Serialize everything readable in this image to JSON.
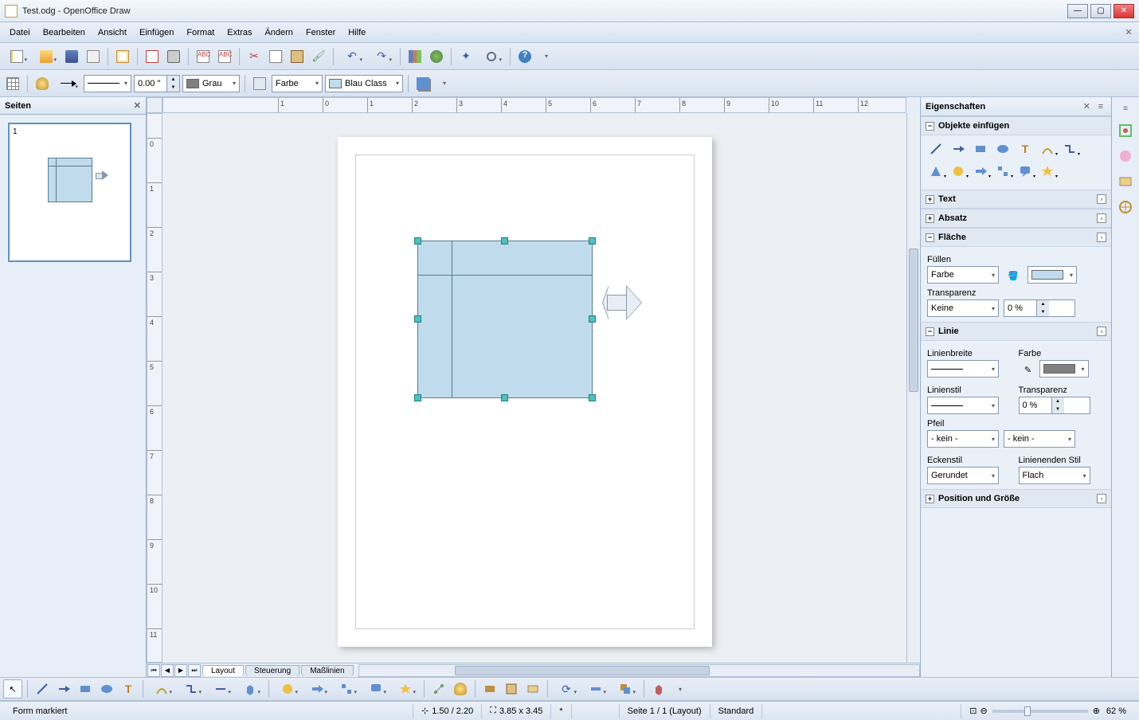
{
  "app": {
    "title": "Test.odg - OpenOffice Draw"
  },
  "menu": [
    "Datei",
    "Bearbeiten",
    "Ansicht",
    "Einfügen",
    "Format",
    "Extras",
    "Ändern",
    "Fenster",
    "Hilfe"
  ],
  "toolbar2": {
    "line_width": "0.00 \"",
    "line_color_label": "Grau",
    "fill_mode": "Farbe",
    "fill_color_label": "Blau Class"
  },
  "pages_panel": {
    "title": "Seiten",
    "page_number": "1"
  },
  "tabs": [
    "Layout",
    "Steuerung",
    "Maßlinien"
  ],
  "properties": {
    "title": "Eigenschaften",
    "insert_title": "Objekte einfügen",
    "text_title": "Text",
    "para_title": "Absatz",
    "area_title": "Fläche",
    "fill_label": "Füllen",
    "fill_mode": "Farbe",
    "transp_label": "Transparenz",
    "transp_mode": "Keine",
    "transp_value": "0 %",
    "line_title": "Linie",
    "line_width_label": "Linienbreite",
    "line_color_label": "Farbe",
    "line_style_label": "Linienstil",
    "line_transp_label": "Transparenz",
    "line_transp_value": "0 %",
    "arrow_label": "Pfeil",
    "arrow_start": "- kein -",
    "arrow_end": "- kein -",
    "corner_label": "Eckenstil",
    "corner_value": "Gerundet",
    "cap_label": "Linienenden Stil",
    "cap_value": "Flach",
    "pos_title": "Position und Größe"
  },
  "status": {
    "selection": "Form markiert",
    "pos": "1.50 / 2.20",
    "size": "3.85 x 3.45",
    "modified": "*",
    "page": "Seite 1 / 1 (Layout)",
    "mode": "Standard",
    "zoom": "62 %"
  },
  "colors": {
    "line_gray": "#808080",
    "fill_blue": "#c0dcec"
  }
}
